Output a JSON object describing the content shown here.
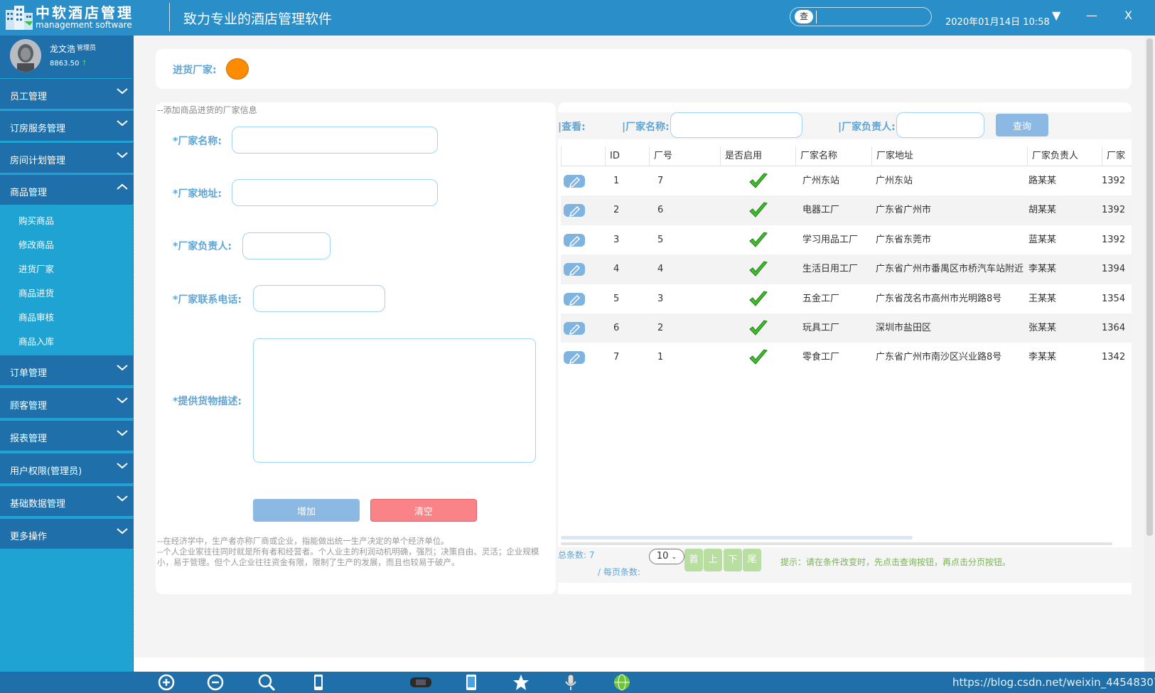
{
  "app": {
    "title": "中软酒店管理",
    "subtitle": "management software",
    "slogan": "致力专业的酒店管理软件",
    "search_button": "查",
    "search_value": "",
    "datetime": "2020年01月14日 10:58",
    "dropdown_glyph": "▼",
    "minimize_glyph": "—",
    "close_glyph": "X"
  },
  "user": {
    "name": "龙文浩",
    "role": "管理员",
    "balance": "8863.50",
    "balance_arrow": "↑"
  },
  "sidebar": {
    "menus": [
      {
        "label": "员工管理"
      },
      {
        "label": "订房服务管理"
      },
      {
        "label": "房间计划管理"
      },
      {
        "label": "商品管理"
      },
      {
        "label": "订单管理"
      },
      {
        "label": "顾客管理"
      },
      {
        "label": "报表管理"
      },
      {
        "label": "用户权限(管理员)"
      },
      {
        "label": "基础数据管理"
      },
      {
        "label": "更多操作"
      }
    ],
    "submenu": [
      {
        "label": "购买商品"
      },
      {
        "label": "修改商品"
      },
      {
        "label": "进货厂家"
      },
      {
        "label": "商品进货"
      },
      {
        "label": "商品审核"
      },
      {
        "label": "商品入库"
      }
    ]
  },
  "topbar": {
    "label": "进货厂家:",
    "accent_color": "#ff8c00"
  },
  "form": {
    "note": "--添加商品进货的厂家信息",
    "name_label": "*厂家名称:",
    "name_value": "",
    "address_label": "*厂家地址:",
    "address_value": "",
    "manager_label": "*厂家负责人:",
    "manager_value": "",
    "phone_label": "*厂家联系电话:",
    "phone_value": "",
    "desc_label": "*提供货物描述:",
    "desc_value": "",
    "add_button": "增加",
    "clear_button": "清空",
    "footer_line1": "--在经济学中，生产者亦称厂商或企业，指能做出统一生产决定的单个经济单位。",
    "footer_line2": "--个人企业家往往同时就是所有者和经营者。个人业主的利润动机明确，强烈；决策自由、灵活；企业规模小，易于管理。但个人企业往往资金有限，限制了生产的发展，而且也较易于破产。"
  },
  "query": {
    "view_label": "|查看:",
    "name_label": "|厂家名称:",
    "name_value": "",
    "manager_label": "|厂家负责人:",
    "manager_value": "",
    "button": "查询"
  },
  "table": {
    "columns": [
      "ID",
      "厂号",
      "是否启用",
      "厂家名称",
      "厂家地址",
      "厂家负责人",
      "厂家"
    ],
    "rows": [
      {
        "id": "1",
        "no": "7",
        "name": "广州东站",
        "address": "广州东站",
        "manager": "路某某",
        "phone": "1392"
      },
      {
        "id": "2",
        "no": "6",
        "name": "电器工厂",
        "address": "广东省广州市",
        "manager": "胡某某",
        "phone": "1392"
      },
      {
        "id": "3",
        "no": "5",
        "name": "学习用品工厂",
        "address": "广东省东莞市",
        "manager": "蓝某某",
        "phone": "1392"
      },
      {
        "id": "4",
        "no": "4",
        "name": "生活日用工厂",
        "address": "广东省广州市番禺区市桥汽车站附近",
        "manager": "李某某",
        "phone": "1394"
      },
      {
        "id": "5",
        "no": "3",
        "name": "五金工厂",
        "address": "广东省茂名市高州市光明路8号",
        "manager": "王某某",
        "phone": "1354"
      },
      {
        "id": "6",
        "no": "2",
        "name": "玩具工厂",
        "address": "深圳市盐田区",
        "manager": "张某某",
        "phone": "1364"
      },
      {
        "id": "7",
        "no": "1",
        "name": "零食工厂",
        "address": "广东省广州市南沙区兴业路8号",
        "manager": "李某某",
        "phone": "1342"
      }
    ]
  },
  "pager": {
    "total_label": "总条数:",
    "total": "7",
    "per_page_label": "/ 每页条数:",
    "per_page": "10",
    "first": "首",
    "prev": "上",
    "next": "下",
    "last": "尾",
    "tip": "提示：请在条件改变时，先点击查询按钮，再点击分页按钮。"
  },
  "footer": {
    "watermark": "https://blog.csdn.net/weixin_44548307",
    "taskbar_icons": [
      "zoom-in-icon",
      "zoom-out-icon",
      "search-icon",
      "phone-icon",
      "game-console-icon",
      "tablet-icon",
      "star-icon",
      "microphone-icon",
      "globe-icon"
    ]
  },
  "colors": {
    "header": "#2a8fc9",
    "sidebar": "#1ea3d3",
    "menu": "#1f6fab",
    "label_blue": "#5fa6d8",
    "add_button": "#8cb9e3",
    "clear_button": "#f98386",
    "pager_button": "#b8dfa1"
  }
}
